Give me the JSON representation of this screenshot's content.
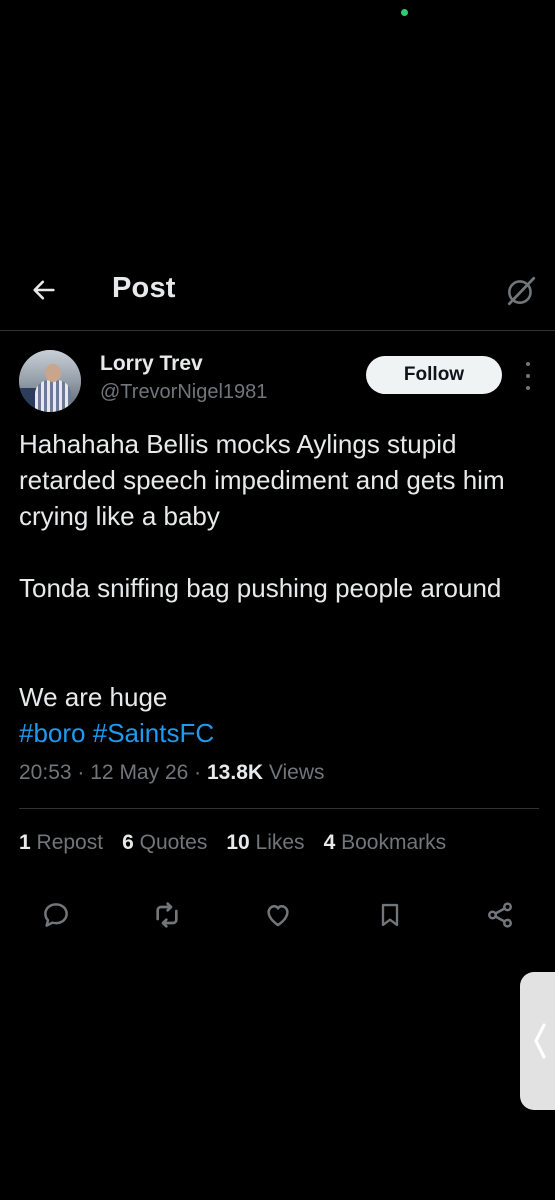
{
  "header": {
    "title": "Post"
  },
  "tweet": {
    "display_name": "Lorry Trev",
    "handle": "@TrevorNigel1981",
    "follow_label": "Follow",
    "paragraph1": "Hahahaha Bellis mocks Aylings stupid retarded speech impediment and gets him crying like a baby",
    "paragraph2": "Tonda sniffing bag pushing people around",
    "paragraph3": "We are huge",
    "hashtags": [
      "#boro",
      "#SaintsFC"
    ],
    "time": "20:53",
    "date": "12 May 26",
    "views_count": "13.8K",
    "views_label": "Views",
    "separator": "·"
  },
  "stats": {
    "reposts": {
      "count": "1",
      "label": "Repost"
    },
    "quotes": {
      "count": "6",
      "label": "Quotes"
    },
    "likes": {
      "count": "10",
      "label": "Likes"
    },
    "bookmarks": {
      "count": "4",
      "label": "Bookmarks"
    }
  },
  "icons": {
    "back": "arrow-left-icon",
    "grok": "grok-icon",
    "more": "more-vertical-icon",
    "reply": "reply-icon",
    "repost": "repost-icon",
    "like": "heart-icon",
    "bookmark": "bookmark-icon",
    "share": "share-icon",
    "edge_panel": "chevron-left-icon"
  },
  "colors": {
    "background": "#000000",
    "text": "#e7e9ea",
    "muted": "#71767b",
    "link": "#1d9bf0",
    "follow_bg": "#eff3f4",
    "divider": "#2f3336"
  }
}
